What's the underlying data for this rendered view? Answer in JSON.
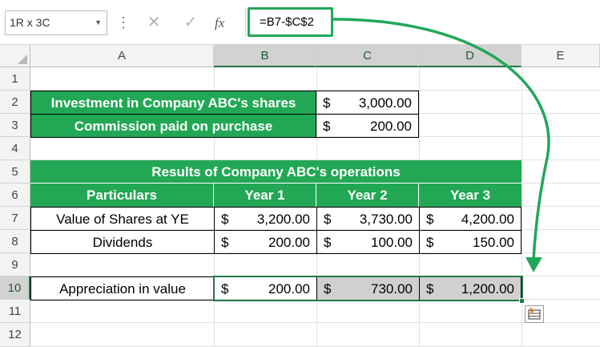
{
  "formula_bar": {
    "name_box": "1R x 3C",
    "cancel_icon": "✕",
    "enter_icon": "✓",
    "fx_label": "fx",
    "formula": "=B7-$C$2"
  },
  "columns": [
    "A",
    "B",
    "C",
    "D",
    "E"
  ],
  "rows": [
    "1",
    "2",
    "3",
    "4",
    "5",
    "6",
    "7",
    "8",
    "9",
    "10",
    "11",
    "12"
  ],
  "cells": {
    "a2": "Investment in Company ABC's shares",
    "c2": {
      "sym": "$",
      "num": "3,000.00"
    },
    "a3": "Commission paid on purchase",
    "c3": {
      "sym": "$",
      "num": "200.00"
    },
    "title": "Results of Company ABC's operations",
    "a6": "Particulars",
    "b6": "Year 1",
    "c6": "Year 2",
    "d6": "Year 3",
    "a7": "Value of Shares at YE",
    "b7": {
      "sym": "$",
      "num": "3,200.00"
    },
    "c7": {
      "sym": "$",
      "num": "3,730.00"
    },
    "d7": {
      "sym": "$",
      "num": "4,200.00"
    },
    "a8": "Dividends",
    "b8": {
      "sym": "$",
      "num": "200.00"
    },
    "c8": {
      "sym": "$",
      "num": "100.00"
    },
    "d8": {
      "sym": "$",
      "num": "150.00"
    },
    "a10": "Appreciation in value",
    "b10": {
      "sym": "$",
      "num": "200.00"
    },
    "c10": {
      "sym": "$",
      "num": "730.00"
    },
    "d10": {
      "sym": "$",
      "num": "1,200.00"
    }
  },
  "colors": {
    "header_green": "#22a854",
    "selection_green": "#1f7a45",
    "annotation_green": "#22a758"
  }
}
